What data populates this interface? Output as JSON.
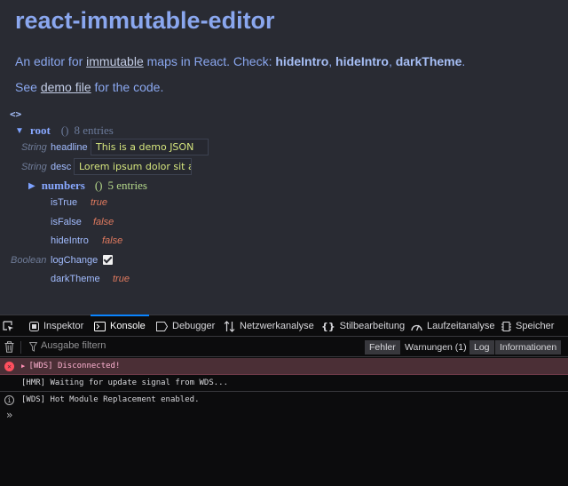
{
  "page": {
    "title": "react-immutable-editor",
    "intro_prefix": "An editor for ",
    "intro_link": "immutable",
    "intro_mid": " maps in React. Check: ",
    "check_1": "hideIntro",
    "check_sep_1": ", ",
    "check_2": "hideIntro",
    "check_sep_2": ", ",
    "check_3": "darkTheme",
    "intro_end": ".",
    "see_prefix": "See ",
    "see_link": "demo file",
    "see_suffix": " for the code."
  },
  "editor": {
    "code_toggle": "<>",
    "root": {
      "key": "root",
      "paren": "()",
      "entries": "8 entries",
      "caret": "▼"
    },
    "rows": [
      {
        "type": "String",
        "key": "headline",
        "value": "This is a demo JSON"
      },
      {
        "type": "String",
        "key": "desc",
        "value": "Lorem ipsum dolor sit an"
      }
    ],
    "numbers": {
      "key": "numbers",
      "paren": "()",
      "entries": "5 entries",
      "caret": "▶"
    },
    "bools": [
      {
        "key": "isTrue",
        "value": "true"
      },
      {
        "key": "isFalse",
        "value": "false"
      },
      {
        "key": "hideIntro",
        "value": "false"
      }
    ],
    "log_change": {
      "type": "Boolean",
      "key": "logChange",
      "checked": true
    },
    "dark_theme": {
      "key": "darkTheme",
      "value": "true"
    }
  },
  "devtools": {
    "tabs": [
      {
        "icon": "inspector-icon",
        "label": "Inspektor"
      },
      {
        "icon": "console-icon",
        "label": "Konsole"
      },
      {
        "icon": "debugger-icon",
        "label": "Debugger"
      },
      {
        "icon": "network-icon",
        "label": "Netzwerkanalyse"
      },
      {
        "icon": "style-editor-icon",
        "label": "Stilbearbeitung"
      },
      {
        "icon": "performance-icon",
        "label": "Laufzeitanalyse"
      },
      {
        "icon": "storage-icon",
        "label": "Speicher"
      }
    ],
    "active_tab": "Konsole",
    "filter_placeholder": "Ausgabe filtern",
    "filter_buttons": [
      "Fehler",
      "Warnungen (1)",
      "Log",
      "Informationen"
    ],
    "messages": [
      {
        "level": "error",
        "text": "[WDS] Disconnected!"
      },
      {
        "level": "log",
        "text": "[HMR] Waiting for update signal from WDS..."
      },
      {
        "level": "info",
        "text": "[WDS] Hot Module Replacement enabled."
      }
    ],
    "prompt": "»"
  },
  "colors": {
    "page_bg": "#292b33",
    "title": "#8aa7ef",
    "string_value": "#d6e67e",
    "bool_value": "#e07a5f",
    "devtools_bg": "#0c0c0d",
    "active_tab": "#0a84ff",
    "error_bg": "#4b2f36"
  }
}
